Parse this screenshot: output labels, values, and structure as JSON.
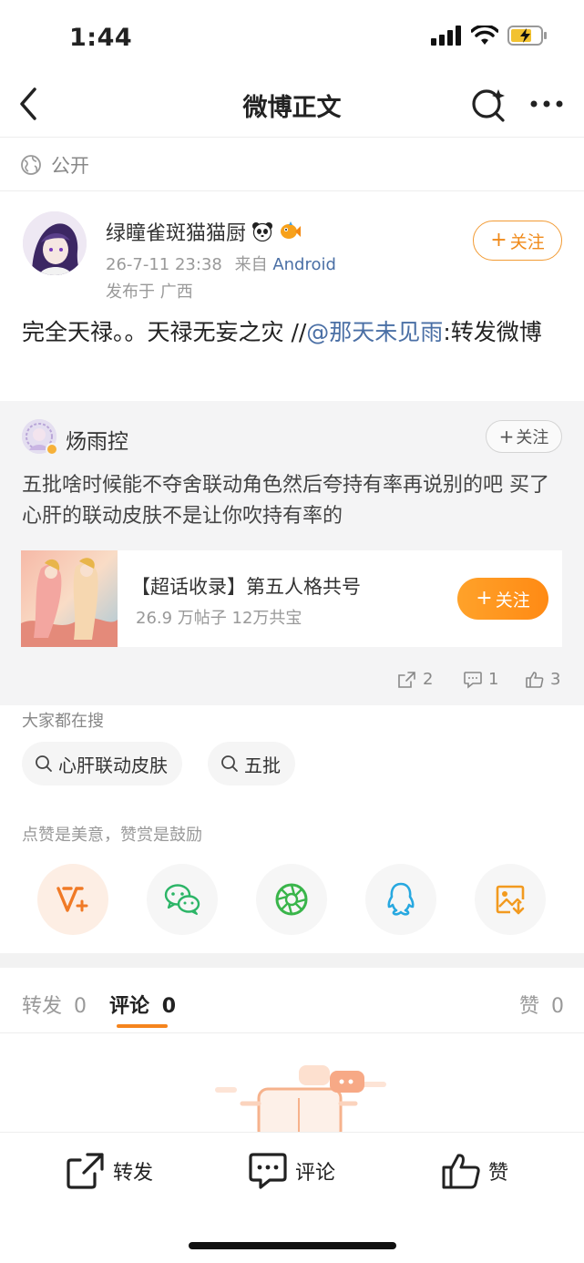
{
  "status_bar": {
    "time": "1:44"
  },
  "nav": {
    "title": "微博正文"
  },
  "visibility": {
    "label": "公开"
  },
  "author": {
    "name": "绿瞳雀斑猫猫厨",
    "date": "26-7-11 23:38",
    "via": "来自",
    "source": "Android",
    "location": "发布于 广西",
    "follow_label": "关注"
  },
  "post": {
    "text_before": "完全天禄。。天禄无妄之灾 //",
    "mention": "@那天未见雨",
    "text_after": ":转发微博"
  },
  "repost": {
    "author": "炀雨控",
    "follow_label": "关注",
    "text": "五批啥时候能不夺舍联动角色然后夸持有率再说别的吧 买了心肝的联动皮肤不是让你吹持有率的",
    "topic": {
      "title": "【超话收录】第五人格共号",
      "stats": "26.9 万帖子  12万共宝",
      "follow_label": "关注"
    },
    "actions": {
      "reposts": "2",
      "comments": "1",
      "likes": "3"
    }
  },
  "search": {
    "label": "大家都在搜",
    "chips": [
      "心肝联动皮肤",
      "五批"
    ]
  },
  "reward": {
    "label": "点赞是美意，赞赏是鼓励"
  },
  "tabs": {
    "repost": "转发",
    "repost_count": "0",
    "comment": "评论",
    "comment_count": "0",
    "like": "赞",
    "like_count": "0"
  },
  "bottom_bar": {
    "repost": "转发",
    "comment": "评论",
    "like": "赞"
  },
  "colors": {
    "accent": "#f5841d",
    "link": "#4a6fa5"
  }
}
